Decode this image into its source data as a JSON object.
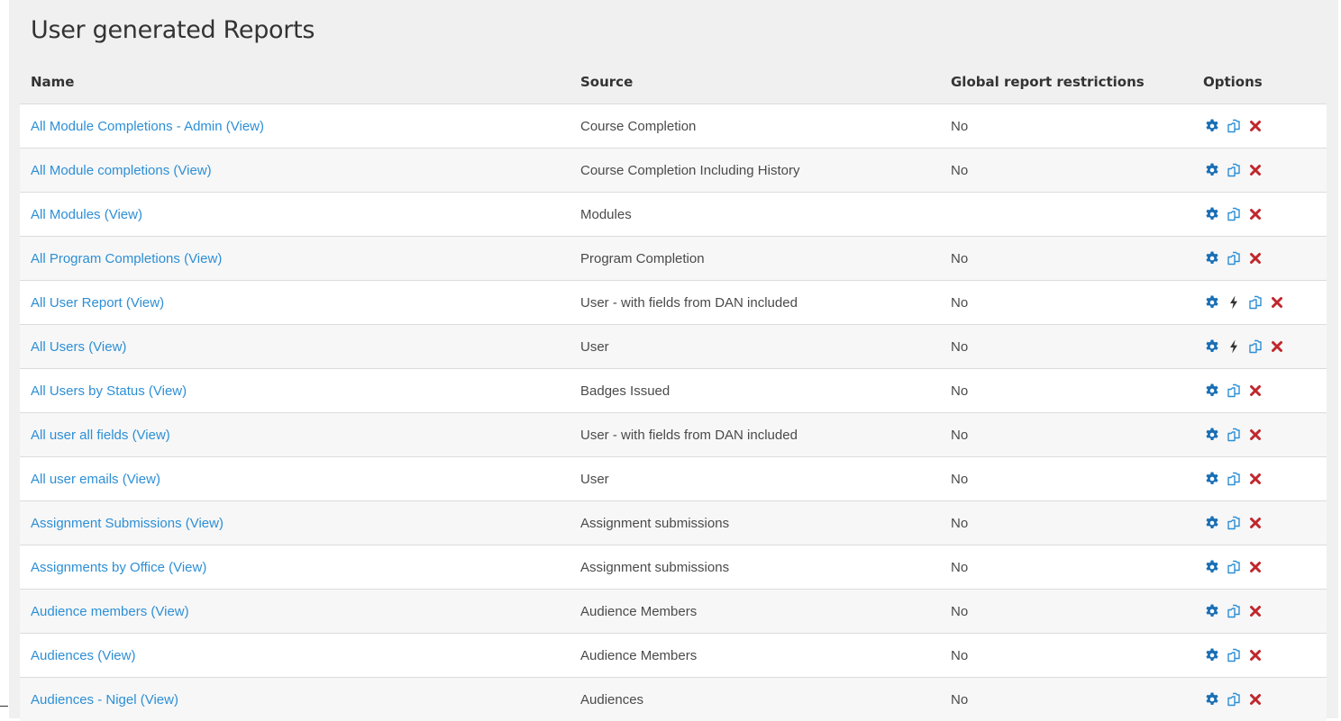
{
  "page": {
    "title": "User generated Reports"
  },
  "table": {
    "columns": [
      "Name",
      "Source",
      "Global report restrictions",
      "Options"
    ],
    "view_label": "(View)",
    "rows": [
      {
        "name": "All Module Completions - Admin",
        "source": "Course Completion",
        "global": "No",
        "options": [
          "settings",
          "clone",
          "delete"
        ]
      },
      {
        "name": "All Module completions",
        "source": "Course Completion Including History",
        "global": "No",
        "options": [
          "settings",
          "clone",
          "delete"
        ]
      },
      {
        "name": "All Modules",
        "source": "Modules",
        "global": "",
        "options": [
          "settings",
          "clone",
          "delete"
        ]
      },
      {
        "name": "All Program Completions",
        "source": "Program Completion",
        "global": "No",
        "options": [
          "settings",
          "clone",
          "delete"
        ]
      },
      {
        "name": "All User Report",
        "source": "User - with fields from DAN included",
        "global": "No",
        "options": [
          "settings",
          "cache",
          "clone",
          "delete"
        ]
      },
      {
        "name": "All Users",
        "source": "User",
        "global": "No",
        "options": [
          "settings",
          "cache",
          "clone",
          "delete"
        ]
      },
      {
        "name": "All Users by Status",
        "source": "Badges Issued",
        "global": "No",
        "options": [
          "settings",
          "clone",
          "delete"
        ]
      },
      {
        "name": "All user all fields",
        "source": "User - with fields from DAN included",
        "global": "No",
        "options": [
          "settings",
          "clone",
          "delete"
        ]
      },
      {
        "name": "All user emails",
        "source": "User",
        "global": "No",
        "options": [
          "settings",
          "clone",
          "delete"
        ]
      },
      {
        "name": "Assignment Submissions",
        "source": "Assignment submissions",
        "global": "No",
        "options": [
          "settings",
          "clone",
          "delete"
        ]
      },
      {
        "name": "Assignments by Office",
        "source": "Assignment submissions",
        "global": "No",
        "options": [
          "settings",
          "clone",
          "delete"
        ]
      },
      {
        "name": "Audience members",
        "source": "Audience Members",
        "global": "No",
        "options": [
          "settings",
          "clone",
          "delete"
        ]
      },
      {
        "name": "Audiences",
        "source": "Audience Members",
        "global": "No",
        "options": [
          "settings",
          "clone",
          "delete"
        ]
      },
      {
        "name": "Audiences - Nigel",
        "source": "Audiences",
        "global": "No",
        "options": [
          "settings",
          "clone",
          "delete"
        ]
      }
    ]
  },
  "icons": {
    "settings": {
      "name": "gear-icon",
      "color": "#1a6fb4"
    },
    "cache": {
      "name": "lightning-icon",
      "color": "#333333"
    },
    "clone": {
      "name": "clone-icon",
      "color": "#2d8fd5"
    },
    "delete": {
      "name": "delete-icon",
      "color": "#c0272d"
    }
  },
  "colors": {
    "link": "#2d8fd5",
    "panel": "#f0f0f0"
  }
}
